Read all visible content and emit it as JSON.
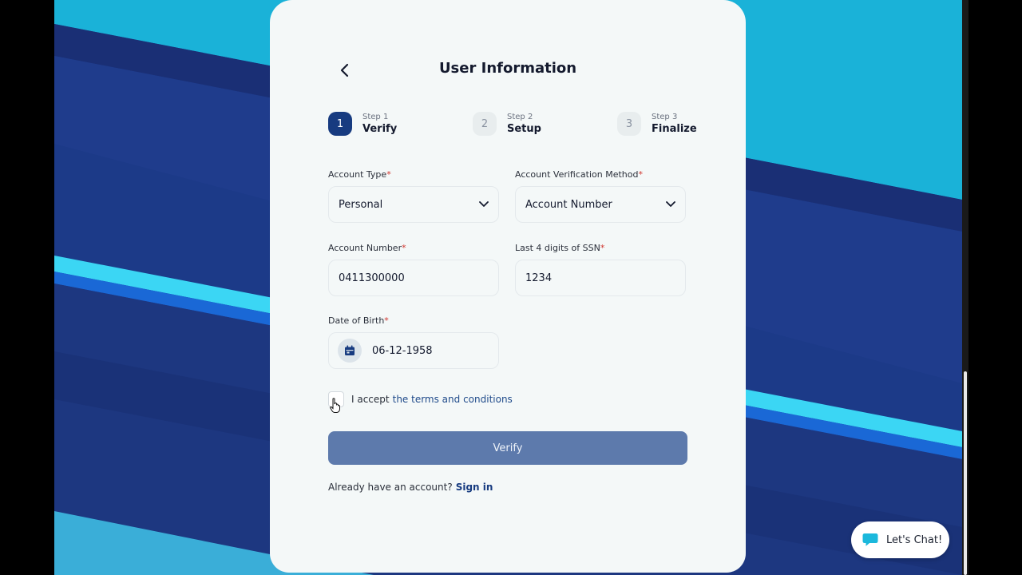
{
  "header": {
    "title": "User Information",
    "back_icon": "chevron-left-icon"
  },
  "stepper": {
    "steps": [
      {
        "number": "1",
        "small": "Step 1",
        "label": "Verify",
        "active": true
      },
      {
        "number": "2",
        "small": "Step 2",
        "label": "Setup",
        "active": false
      },
      {
        "number": "3",
        "small": "Step 3",
        "label": "Finalize",
        "active": false
      }
    ]
  },
  "form": {
    "account_type": {
      "label": "Account Type",
      "required_mark": "*",
      "value": "Personal"
    },
    "verification_method": {
      "label": "Account Verification Method",
      "required_mark": "*",
      "value": "Account Number"
    },
    "account_number": {
      "label": "Account Number",
      "required_mark": "*",
      "value": "0411300000"
    },
    "ssn_last4": {
      "label": "Last 4 digits of SSN",
      "required_mark": "*",
      "value": "1234"
    },
    "dob": {
      "label": "Date of Birth",
      "required_mark": "*",
      "value": "06-12-1958"
    },
    "terms": {
      "text": "I accept",
      "link": "the terms and conditions",
      "checked": false
    },
    "submit_label": "Verify"
  },
  "footer": {
    "prompt": "Already have an account?",
    "signin_label": "Sign in"
  },
  "chat": {
    "label": "Let's Chat!"
  },
  "colors": {
    "primary": "#173b80",
    "button": "#5d7aac",
    "card": "#f4f8f8",
    "required": "#d0362f",
    "accent": "#1bb8dc"
  }
}
